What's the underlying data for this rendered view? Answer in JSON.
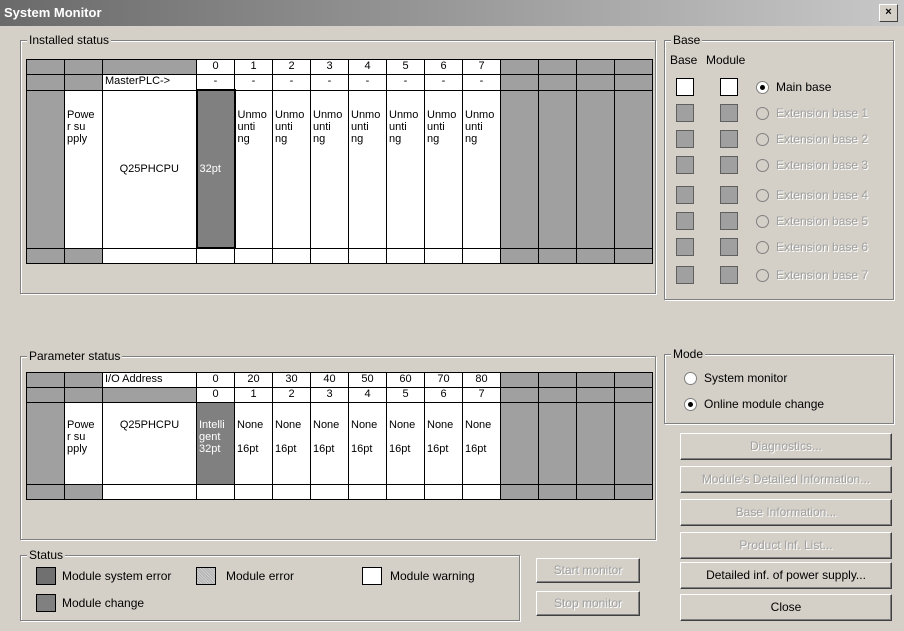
{
  "window": {
    "title": "System Monitor",
    "close_glyph": "×"
  },
  "installed": {
    "label": "Installed status",
    "header_slots": [
      "0",
      "1",
      "2",
      "3",
      "4",
      "5",
      "6",
      "7"
    ],
    "master_label": "MasterPLC->",
    "master_values": [
      "-",
      "-",
      "-",
      "-",
      "-",
      "-",
      "-",
      "-"
    ],
    "power_supply": "Powe\nr su\npply",
    "cpu": "Q25PHCPU",
    "slot0": "32pt",
    "unmounting": "Unmo\nunti\nng"
  },
  "parameter": {
    "label": "Parameter status",
    "io_label": "I/O Address",
    "io_values": [
      "0",
      "20",
      "30",
      "40",
      "50",
      "60",
      "70",
      "80"
    ],
    "slots": [
      "0",
      "1",
      "2",
      "3",
      "4",
      "5",
      "6",
      "7"
    ],
    "power_supply": "Powe\nr su\npply",
    "cpu": "Q25PHCPU",
    "slot0": "Intelli\ngent\n32pt",
    "none_label": "None",
    "pt16": "16pt"
  },
  "base": {
    "label": "Base",
    "col_base": "Base",
    "col_module": "Module",
    "options": [
      "Main base",
      "Extension base 1",
      "Extension base 2",
      "Extension base 3",
      "Extension base 4",
      "Extension base 5",
      "Extension base 6",
      "Extension base 7"
    ]
  },
  "mode": {
    "label": "Mode",
    "options": [
      "System monitor",
      "Online module change"
    ]
  },
  "buttons": {
    "diagnostics": "Diagnostics...",
    "module_detail": "Module's Detailed Information...",
    "base_info": "Base Information...",
    "product_inf": "Product Inf. List...",
    "power_supply_detail": "Detailed inf. of power supply...",
    "close": "Close",
    "start_monitor": "Start monitor",
    "stop_monitor": "Stop monitor"
  },
  "status": {
    "label": "Status",
    "module_system_error": "Module system error",
    "module_error": "Module error",
    "module_warning": "Module warning",
    "module_change": "Module change"
  },
  "colors": {
    "dark_cell": "#808080",
    "gray_cell": "#a0a0a0",
    "title_grad": "#6a6a6a"
  }
}
